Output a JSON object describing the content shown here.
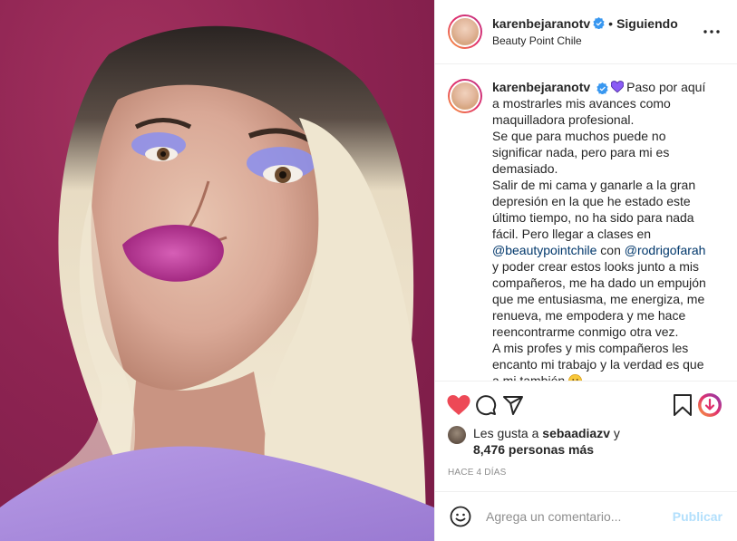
{
  "post": {
    "username": "karenbejaranotv",
    "separator": "•",
    "follow_status": "Siguiendo",
    "location": "Beauty Point Chile"
  },
  "caption": {
    "username": "karenbejaranotv",
    "p1": "Paso por aquí a mostrarles mis avances como maquilladora profesional.",
    "p2": "Se que para muchos puede no significar nada, pero para mi es demasiado.",
    "p3_a": "Salir de mi cama y ganarle a la gran depresión en la que he estado este último tiempo, no ha sido para nada fácil. Pero llegar a clases en",
    "mention1": "@beautypointchile",
    "p3_b": "con",
    "mention2": "@rodrigofarah",
    "p3_c": "y poder crear estos looks junto a mis compañeros, me ha dado un empujón que me entusiasma, me energiza, me renueva, me empodera y me hace reencontrarme conmigo otra vez.",
    "p4": "A mis profes y mis compañeros les encanto mi trabajo y la verdad es que a mi también"
  },
  "likes": {
    "prefix": "Les gusta a",
    "liker": "sebaadiazv",
    "joiner": "y",
    "count": "8,476 personas más"
  },
  "date": "HACE 4 DÍAS",
  "composer": {
    "placeholder": "Agrega un comentario...",
    "publish_label": "Publicar"
  },
  "icons": {
    "like": "heart-filled-icon",
    "comment": "comment-bubble-icon",
    "share": "paper-plane-icon",
    "save": "bookmark-icon",
    "story": "download-badge-icon",
    "options": "more-horizontal-icon",
    "emoji": "smiley-icon"
  },
  "colors": {
    "like_red": "#ed4956",
    "verified_blue": "#3897f0",
    "mention_blue": "#00376b",
    "publish_disabled": "#b2dffc",
    "muted": "#8e8e8e"
  }
}
